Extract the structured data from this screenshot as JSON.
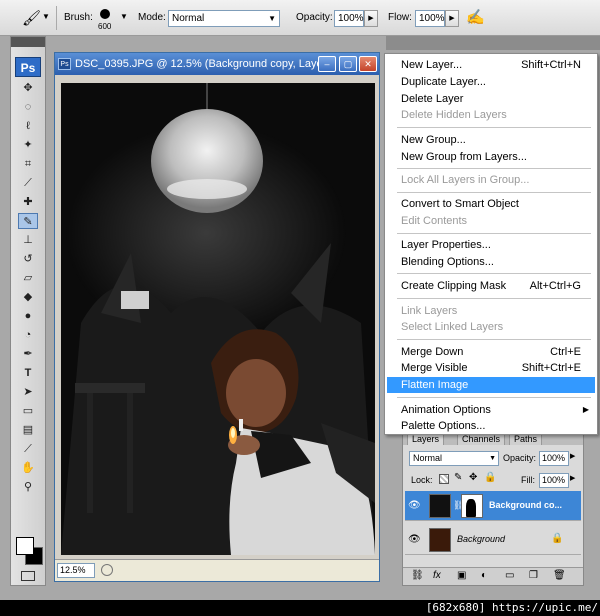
{
  "options_bar": {
    "brush_label": "Brush:",
    "brush_size": "600",
    "mode_label": "Mode:",
    "mode_value": "Normal",
    "opacity_label": "Opacity:",
    "opacity_value": "100%",
    "flow_label": "Flow:",
    "flow_value": "100%"
  },
  "toolbox": {
    "logo": "Ps"
  },
  "document": {
    "title": "DSC_0395.JPG @ 12.5% (Background copy, Laye...",
    "zoom": "12.5%"
  },
  "context_menu": {
    "items": [
      {
        "label": "New Layer...",
        "shortcut": "Shift+Ctrl+N",
        "disabled": false
      },
      {
        "label": "Duplicate Layer...",
        "shortcut": "",
        "disabled": false
      },
      {
        "label": "Delete Layer",
        "shortcut": "",
        "disabled": false
      },
      {
        "label": "Delete Hidden Layers",
        "shortcut": "",
        "disabled": true
      },
      {
        "label": "New Group...",
        "shortcut": "",
        "disabled": false
      },
      {
        "label": "New Group from Layers...",
        "shortcut": "",
        "disabled": false
      },
      {
        "label": "Lock All Layers in Group...",
        "shortcut": "",
        "disabled": true
      },
      {
        "label": "Convert to Smart Object",
        "shortcut": "",
        "disabled": false
      },
      {
        "label": "Edit Contents",
        "shortcut": "",
        "disabled": true
      },
      {
        "label": "Layer Properties...",
        "shortcut": "",
        "disabled": false
      },
      {
        "label": "Blending Options...",
        "shortcut": "",
        "disabled": false
      },
      {
        "label": "Create Clipping Mask",
        "shortcut": "Alt+Ctrl+G",
        "disabled": false
      },
      {
        "label": "Link Layers",
        "shortcut": "",
        "disabled": true
      },
      {
        "label": "Select Linked Layers",
        "shortcut": "",
        "disabled": true
      },
      {
        "label": "Merge Down",
        "shortcut": "Ctrl+E",
        "disabled": false
      },
      {
        "label": "Merge Visible",
        "shortcut": "Shift+Ctrl+E",
        "disabled": false
      },
      {
        "label": "Flatten Image",
        "shortcut": "",
        "disabled": false,
        "highlighted": true
      },
      {
        "label": "Animation Options",
        "shortcut": "",
        "disabled": false,
        "submenu": true
      },
      {
        "label": "Palette Options...",
        "shortcut": "",
        "disabled": false
      }
    ]
  },
  "layers_panel": {
    "tabs": [
      "Layers",
      "Channels",
      "Paths"
    ],
    "blend_mode": "Normal",
    "opacity_label": "Opacity:",
    "opacity_value": "100%",
    "lock_label": "Lock:",
    "fill_label": "Fill:",
    "fill_value": "100%",
    "layers": [
      {
        "name": "Background co...",
        "selected": true
      },
      {
        "name": "Background",
        "selected": false
      }
    ]
  },
  "watermark": "[682x680] https://upic.me/",
  "colors": {
    "menu_highlight": "#3399ff",
    "layer_selected": "#3d86d6",
    "title_bar": "#2c5fae"
  }
}
